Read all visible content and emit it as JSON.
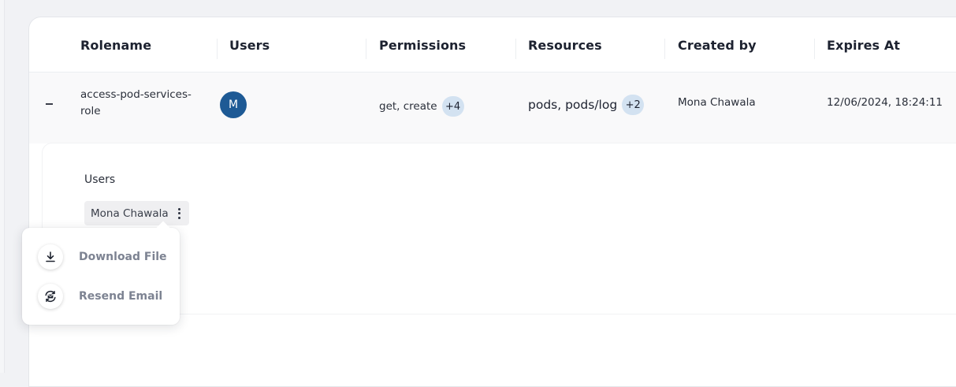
{
  "table": {
    "columns": [
      "Rolename",
      "Users",
      "Permissions",
      "Resources",
      "Created by",
      "Expires At"
    ],
    "rows": [
      {
        "rolename": "access-pod-services-role",
        "user_initial": "M",
        "permissions_text": "get, create",
        "permissions_more": "+4",
        "resources_text": "pods, pods/log",
        "resources_more": "+2",
        "created_by": "Mona Chawala",
        "expires_at": "12/06/2024, 18:24:11",
        "expanded": true
      }
    ]
  },
  "detail": {
    "users_label": "Users",
    "users": [
      "Mona Chawala"
    ]
  },
  "context_menu": {
    "items": [
      {
        "label": "Download File",
        "icon": "download-icon"
      },
      {
        "label": "Resend Email",
        "icon": "resend-email-icon"
      }
    ]
  },
  "colors": {
    "avatar_bg": "#1e5a95",
    "count_chip_bg": "#d3e2f1",
    "menu_label": "#7d8392"
  }
}
